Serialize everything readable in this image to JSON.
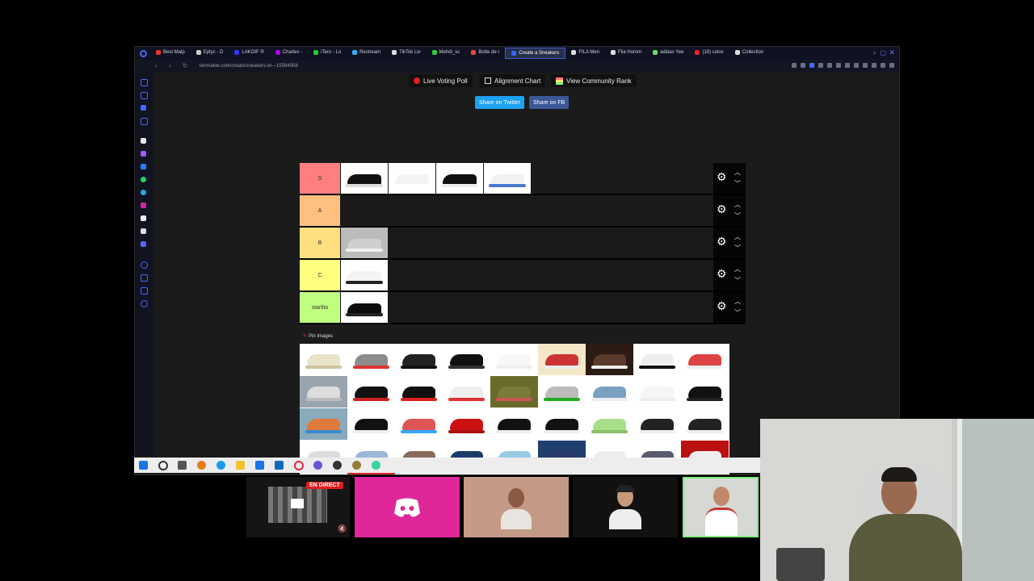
{
  "browser": {
    "tabs": [
      "Best Malp",
      "Eptyc - D",
      "LAKOIF ®",
      "Charles -",
      "iTero - Lo",
      "Restream",
      "TikTok Liv",
      "Mehdi_sc",
      "Boîte de r",
      "Create a Sneakers",
      "FILA Men",
      "Fila Homm",
      "adidas Yee",
      "(18) coloc",
      "Collection"
    ],
    "active_tab": 9,
    "url": "tiermaker.com/create/sneakers-et---15594958"
  },
  "toolbar": {
    "live_voting": "Live Voting Poll",
    "alignment": "Alignment Chart",
    "community": "View Community Rank",
    "share_twitter": "Share on Twitter",
    "share_fb": "Share on FB"
  },
  "tiers": [
    {
      "label": "S",
      "color": "#ff7f7f",
      "items": 4
    },
    {
      "label": "A",
      "color": "#ffbf7f",
      "items": 0
    },
    {
      "label": "B",
      "color": "#ffdf7f",
      "items": 1
    },
    {
      "label": "C",
      "color": "#ffff7f",
      "items": 1
    },
    {
      "label": "starlito",
      "color": "#bfff7f",
      "items": 1
    }
  ],
  "pin_label": "Pin Images",
  "stream": {
    "live_badge": "EN DIRECT"
  },
  "colors": {
    "share_twitter": "#1da1f2",
    "share_fb": "#3b5998",
    "live_red": "#e31c1c",
    "discord": "#e0279a"
  }
}
